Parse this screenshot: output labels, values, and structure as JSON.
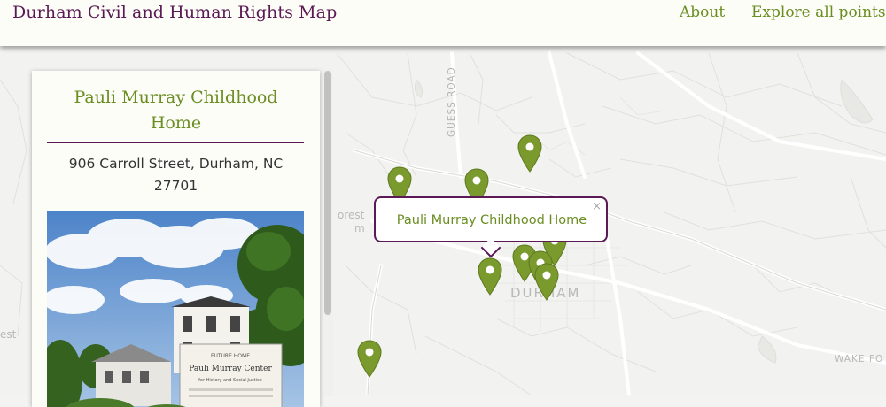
{
  "header": {
    "title": "Durham Civil and Human Rights Map",
    "nav": [
      {
        "label": "About"
      },
      {
        "label": "Explore all points"
      }
    ]
  },
  "panel": {
    "title": "Pauli Murray Childhood Home",
    "address": "906 Carroll Street, Durham, NC 27701",
    "photo_sign": {
      "line1": "FUTURE HOME",
      "line2": "Pauli Murray Center",
      "line3": "for History and Social Justice"
    }
  },
  "popup": {
    "title": "Pauli Murray Childhood Home",
    "close": "×"
  },
  "map": {
    "labels": {
      "road_guess": "GUESS ROAD",
      "city": "DURHAM",
      "forest_1": "orest",
      "forest_2": "m",
      "forest_left": "est",
      "wake_forest": "WAKE FO"
    },
    "marker_color": "#7b9a2e",
    "accent_purple": "#5b1a55"
  }
}
